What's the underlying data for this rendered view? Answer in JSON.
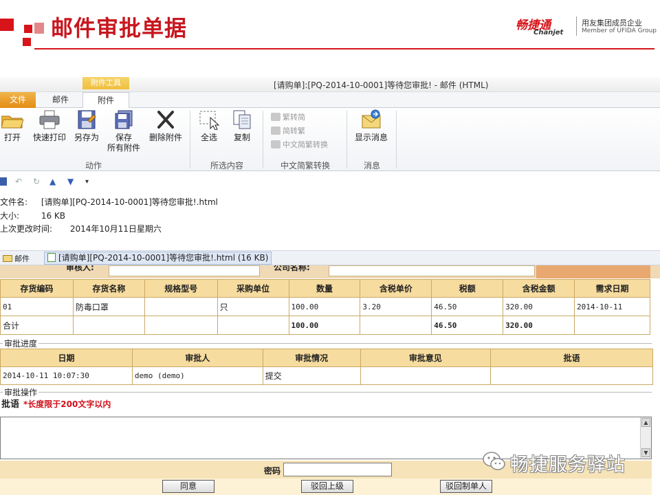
{
  "slide": {
    "title": "邮件审批单据",
    "brand_cn": "畅捷通",
    "brand_en": "Chanjet",
    "brand_sub1": "用友集团成员企业",
    "brand_sub2": "Member of UFIDA Group",
    "accent": "#d7141a"
  },
  "window": {
    "title": "[请购单]:[PQ-2014-10-0001]等待您审批! - 邮件 (HTML)",
    "context_group": "附件工具"
  },
  "tabs": {
    "file": "文件",
    "mail": "邮件",
    "attach": "附件"
  },
  "ribbon": {
    "open": "打开",
    "quick_print": "快速打印",
    "save_as": "另存为",
    "save_all_1": "保存",
    "save_all_2": "所有附件",
    "delete_attach": "删除附件",
    "select_all": "全选",
    "copy": "复制",
    "trad_to_simp": "繁转简",
    "simp_to_trad": "简转繁",
    "cn_convert": "中文简繁转换",
    "show_message": "显示消息",
    "group_action": "动作",
    "group_selection": "所选内容",
    "group_cn_convert": "中文简繁转换",
    "group_message": "消息"
  },
  "file_meta": {
    "name_label": "文件名:",
    "name_value": "[请购单][PQ-2014-10-0001]等待您审批!.html",
    "size_label": "大小:",
    "size_value": "16 KB",
    "modified_label": "上次更改时间:",
    "modified_value": "2014年10月11日星期六"
  },
  "attach_bar": {
    "mail_label": "邮件",
    "file_label": "[请购单][PQ-2014-10-0001]等待您审批!.html (16 KB)"
  },
  "form": {
    "top_label_1": "审核人:",
    "top_label_2": "公司名称:",
    "items_headers": [
      "存货编码",
      "存货名称",
      "规格型号",
      "采购单位",
      "数量",
      "含税单价",
      "税额",
      "含税金额",
      "需求日期"
    ],
    "items_rows": [
      [
        "01",
        "防毒口罩",
        "",
        "只",
        "100.00",
        "3.20",
        "46.50",
        "320.00",
        "2014-10-11"
      ]
    ],
    "total_row": [
      "合计",
      "",
      "",
      "",
      "100.00",
      "",
      "46.50",
      "320.00",
      ""
    ],
    "progress_label": "审批进度",
    "approval_headers": [
      "日期",
      "审批人",
      "审批情况",
      "审批意见",
      "批语"
    ],
    "approval_rows": [
      [
        "2014-10-11 10:07:30",
        "demo (demo)",
        "提交",
        "",
        ""
      ]
    ],
    "operation_label": "审批操作",
    "comment_label": "批语",
    "comment_hint": "*长度限于200文字以内",
    "password_label": "密码",
    "btn_agree": "同意",
    "btn_reject_up": "驳回上级",
    "btn_reject_maker": "驳回制单人"
  },
  "watermark": {
    "text": "畅捷服务驿站",
    "icon": "wechat-icon"
  }
}
